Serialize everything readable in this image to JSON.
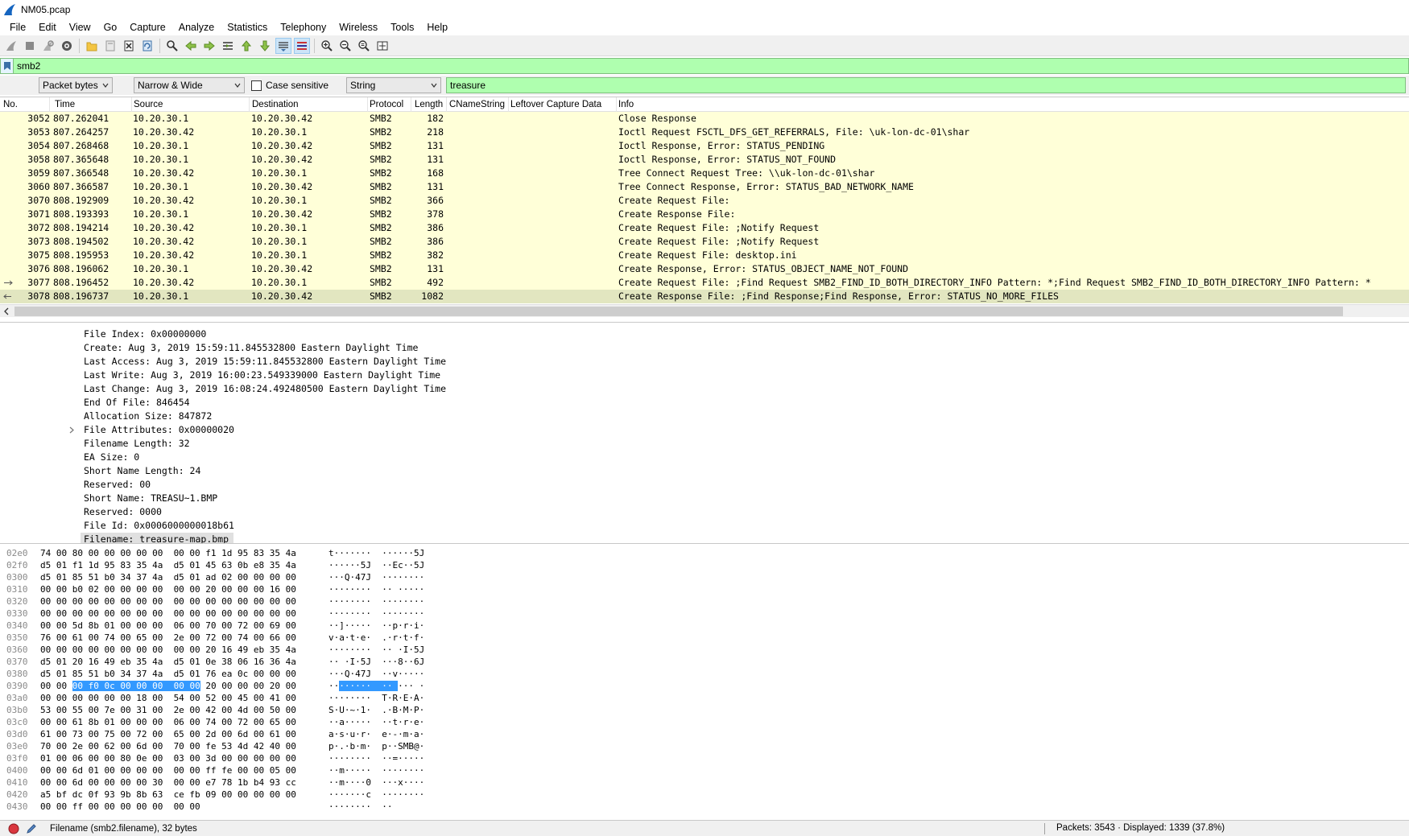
{
  "window": {
    "title": "NM05.pcap"
  },
  "menu": [
    "File",
    "Edit",
    "View",
    "Go",
    "Capture",
    "Analyze",
    "Statistics",
    "Telephony",
    "Wireless",
    "Tools",
    "Help"
  ],
  "filter": {
    "value": "smb2"
  },
  "find": {
    "search_in": "Packet bytes",
    "char_width": "Narrow & Wide",
    "case_sensitive_label": "Case sensitive",
    "search_type": "String",
    "query": "treasure"
  },
  "packet_list": {
    "columns": [
      "No.",
      "Time",
      "Source",
      "Destination",
      "Protocol",
      "Length",
      "CNameString",
      "Leftover Capture Data",
      "Info"
    ],
    "rows": [
      {
        "no": "3052",
        "time": "807.262041",
        "src": "10.20.30.1",
        "dst": "10.20.30.42",
        "proto": "SMB2",
        "len": "182",
        "info": "Close Response"
      },
      {
        "no": "3053",
        "time": "807.264257",
        "src": "10.20.30.42",
        "dst": "10.20.30.1",
        "proto": "SMB2",
        "len": "218",
        "info": "Ioctl Request FSCTL_DFS_GET_REFERRALS, File: \\uk-lon-dc-01\\shar"
      },
      {
        "no": "3054",
        "time": "807.268468",
        "src": "10.20.30.1",
        "dst": "10.20.30.42",
        "proto": "SMB2",
        "len": "131",
        "info": "Ioctl Response, Error: STATUS_PENDING"
      },
      {
        "no": "3058",
        "time": "807.365648",
        "src": "10.20.30.1",
        "dst": "10.20.30.42",
        "proto": "SMB2",
        "len": "131",
        "info": "Ioctl Response, Error: STATUS_NOT_FOUND"
      },
      {
        "no": "3059",
        "time": "807.366548",
        "src": "10.20.30.42",
        "dst": "10.20.30.1",
        "proto": "SMB2",
        "len": "168",
        "info": "Tree Connect Request Tree: \\\\uk-lon-dc-01\\shar"
      },
      {
        "no": "3060",
        "time": "807.366587",
        "src": "10.20.30.1",
        "dst": "10.20.30.42",
        "proto": "SMB2",
        "len": "131",
        "info": "Tree Connect Response, Error: STATUS_BAD_NETWORK_NAME"
      },
      {
        "no": "3070",
        "time": "808.192909",
        "src": "10.20.30.42",
        "dst": "10.20.30.1",
        "proto": "SMB2",
        "len": "366",
        "info": "Create Request File:"
      },
      {
        "no": "3071",
        "time": "808.193393",
        "src": "10.20.30.1",
        "dst": "10.20.30.42",
        "proto": "SMB2",
        "len": "378",
        "info": "Create Response File:"
      },
      {
        "no": "3072",
        "time": "808.194214",
        "src": "10.20.30.42",
        "dst": "10.20.30.1",
        "proto": "SMB2",
        "len": "386",
        "info": "Create Request File: ;Notify Request"
      },
      {
        "no": "3073",
        "time": "808.194502",
        "src": "10.20.30.42",
        "dst": "10.20.30.1",
        "proto": "SMB2",
        "len": "386",
        "info": "Create Request File: ;Notify Request"
      },
      {
        "no": "3075",
        "time": "808.195953",
        "src": "10.20.30.42",
        "dst": "10.20.30.1",
        "proto": "SMB2",
        "len": "382",
        "info": "Create Request File: desktop.ini"
      },
      {
        "no": "3076",
        "time": "808.196062",
        "src": "10.20.30.1",
        "dst": "10.20.30.42",
        "proto": "SMB2",
        "len": "131",
        "info": "Create Response, Error: STATUS_OBJECT_NAME_NOT_FOUND"
      },
      {
        "no": "3077",
        "time": "808.196452",
        "src": "10.20.30.42",
        "dst": "10.20.30.1",
        "proto": "SMB2",
        "len": "492",
        "info": "Create Request File: ;Find Request SMB2_FIND_ID_BOTH_DIRECTORY_INFO Pattern: *;Find Request SMB2_FIND_ID_BOTH_DIRECTORY_INFO Pattern: *"
      },
      {
        "no": "3078",
        "time": "808.196737",
        "src": "10.20.30.1",
        "dst": "10.20.30.42",
        "proto": "SMB2",
        "len": "1082",
        "info": "Create Response File: ;Find Response;Find Response, Error: STATUS_NO_MORE_FILES"
      }
    ]
  },
  "details": [
    "File Index: 0x00000000",
    "Create: Aug  3, 2019 15:59:11.845532800 Eastern Daylight Time",
    "Last Access: Aug  3, 2019 15:59:11.845532800 Eastern Daylight Time",
    "Last Write: Aug  3, 2019 16:00:23.549339000 Eastern Daylight Time",
    "Last Change: Aug  3, 2019 16:08:24.492480500 Eastern Daylight Time",
    "End Of File: 846454",
    "Allocation Size: 847872",
    "File Attributes: 0x00000020",
    "Filename Length: 32",
    "EA Size: 0",
    "Short Name Length: 24",
    "Reserved: 00",
    "Short Name: TREASU~1.BMP",
    "Reserved: 0000",
    "File Id: 0x0006000000018b61",
    "Filename: treasure-map.bmp"
  ],
  "bytes": [
    {
      "off": "02e0",
      "hex": "74 00 80 00 00 00 00 00  00 00 f1 1d 95 83 35 4a",
      "asc": "t·······  ······5J"
    },
    {
      "off": "02f0",
      "hex": "d5 01 f1 1d 95 83 35 4a  d5 01 45 63 0b e8 35 4a",
      "asc": "······5J  ··Ec··5J"
    },
    {
      "off": "0300",
      "hex": "d5 01 85 51 b0 34 37 4a  d5 01 ad 02 00 00 00 00",
      "asc": "···Q·47J  ········"
    },
    {
      "off": "0310",
      "hex": "00 00 b0 02 00 00 00 00  00 00 20 00 00 00 16 00",
      "asc": "········  ·· ·····"
    },
    {
      "off": "0320",
      "hex": "00 00 00 00 00 00 00 00  00 00 00 00 00 00 00 00",
      "asc": "········  ········"
    },
    {
      "off": "0330",
      "hex": "00 00 00 00 00 00 00 00  00 00 00 00 00 00 00 00",
      "asc": "········  ········"
    },
    {
      "off": "0340",
      "hex": "00 00 5d 8b 01 00 00 00  06 00 70 00 72 00 69 00",
      "asc": "··]·····  ··p·r·i·"
    },
    {
      "off": "0350",
      "hex": "76 00 61 00 74 00 65 00  2e 00 72 00 74 00 66 00",
      "asc": "v·a·t·e·  .·r·t·f·"
    },
    {
      "off": "0360",
      "hex": "00 00 00 00 00 00 00 00  00 00 20 16 49 eb 35 4a",
      "asc": "········  ·· ·I·5J"
    },
    {
      "off": "0370",
      "hex": "d5 01 20 16 49 eb 35 4a  d5 01 0e 38 06 16 36 4a",
      "asc": "·· ·I·5J  ···8··6J"
    },
    {
      "off": "0380",
      "hex": "d5 01 85 51 b0 34 37 4a  d5 01 76 ea 0c 00 00 00",
      "asc": "···Q·47J  ··v·····"
    },
    {
      "off": "0390",
      "hex": "00 00 00 f0 0c 00 00 00  00 00 20 00 00 00 20 00",
      "asc": "········  ·· ··· ·"
    },
    {
      "off": "03a0",
      "hex": "00 00 00 00 00 00 18 00  54 00 52 00 45 00 41 00",
      "asc": "········  T·R·E·A·"
    },
    {
      "off": "03b0",
      "hex": "53 00 55 00 7e 00 31 00  2e 00 42 00 4d 00 50 00",
      "asc": "S·U·~·1·  .·B·M·P·"
    },
    {
      "off": "03c0",
      "hex": "00 00 61 8b 01 00 00 00  06 00 74 00 72 00 65 00",
      "asc": "··a·····  ··t·r·e·"
    },
    {
      "off": "03d0",
      "hex": "61 00 73 00 75 00 72 00  65 00 2d 00 6d 00 61 00",
      "asc": "a·s·u·r·  e·-·m·a·"
    },
    {
      "off": "03e0",
      "hex": "70 00 2e 00 62 00 6d 00  70 00 fe 53 4d 42 40 00",
      "asc": "p·.·b·m·  p··SMB@·"
    },
    {
      "off": "03f0",
      "hex": "01 00 06 00 00 80 0e 00  03 00 3d 00 00 00 00 00",
      "asc": "········  ··=·····"
    },
    {
      "off": "0400",
      "hex": "00 00 6d 01 00 00 00 00  00 00 ff fe 00 00 05 00",
      "asc": "··m·····  ········"
    },
    {
      "off": "0410",
      "hex": "00 00 6d 00 00 00 00 30  00 00 e7 78 1b b4 93 cc",
      "asc": "··m····0  ···x····"
    },
    {
      "off": "0420",
      "hex": "a5 bf dc 0f 93 9b 8b 63  ce fb 09 00 00 00 00 00",
      "asc": "·······c  ········"
    },
    {
      "off": "0430",
      "hex": "00 00 ff 00 00 00 00 00  00 00",
      "asc": "········  ··"
    }
  ],
  "bytes_highlight": {
    "offset": "0390",
    "hex": "00 f0 0c 00 00 00  00 00",
    "asc": "········"
  },
  "status": {
    "field_info": "Filename (smb2.filename), 32 bytes",
    "packets": "Packets: 3543 · Displayed: 1339 (37.8%)"
  },
  "colors": {
    "row_bg": "#ffffd8",
    "row_selected_bg": "#e2e6c0",
    "filter_bg": "#afffaf",
    "highlight": "#3399ff"
  },
  "toolbar_icons": [
    "shark-fin-start-icon",
    "stop-icon",
    "restart-icon",
    "options-gear-icon",
    "open-folder-icon",
    "save-file-icon",
    "close-file-icon",
    "reload-icon",
    "find-packet-icon",
    "go-back-icon",
    "go-forward-icon",
    "go-to-packet-icon",
    "go-first-icon",
    "go-last-icon",
    "autoscroll-icon",
    "colorize-icon",
    "zoom-in-icon",
    "zoom-out-icon",
    "zoom-normal-icon",
    "resize-columns-icon"
  ]
}
